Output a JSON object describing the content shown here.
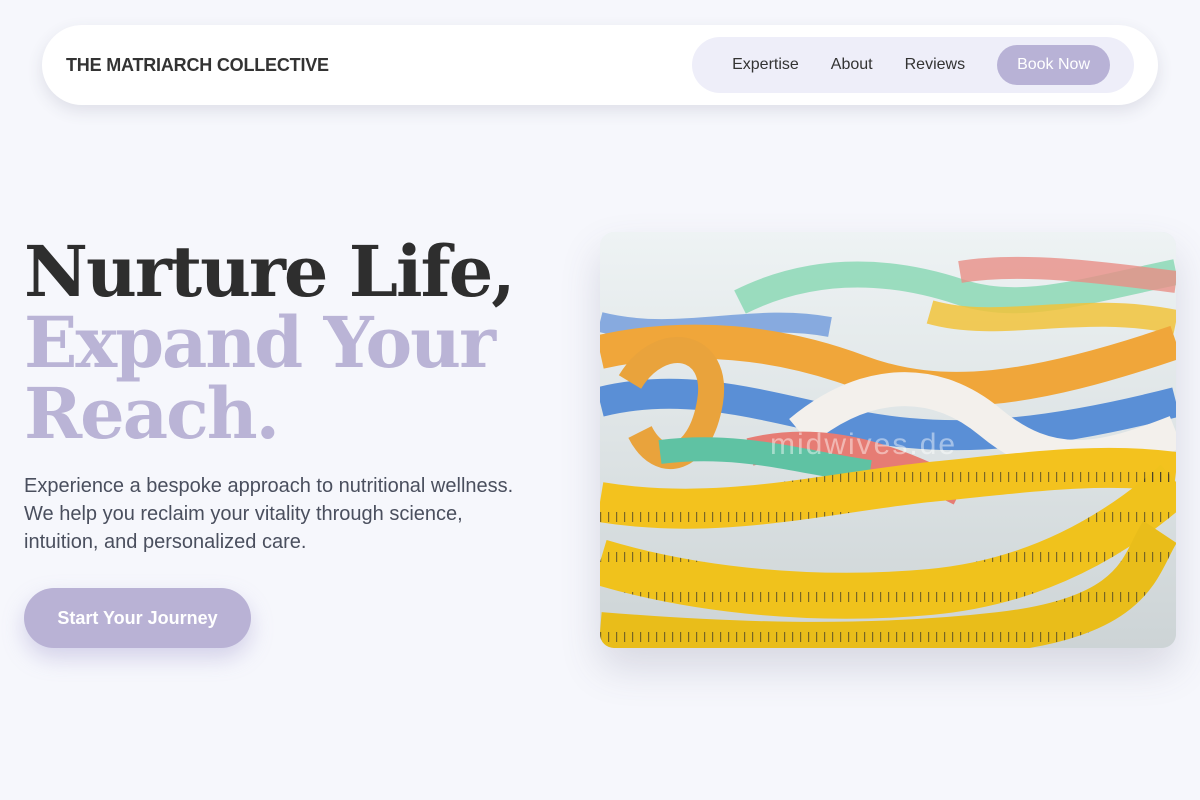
{
  "brand": {
    "name": "THE MATRIARCH COLLECTIVE"
  },
  "nav": {
    "links": [
      "Expertise",
      "About",
      "Reviews"
    ],
    "cta_label": "Book Now"
  },
  "hero": {
    "title_line1": "Nurture Life,",
    "title_line2": "Expand Your",
    "title_line3": "Reach.",
    "subtitle": "Experience a bespoke approach to nutritional wellness. We help you reclaim your vitality through science, intuition, and personalized care.",
    "cta_label": "Start Your Journey",
    "image": {
      "subject": "pile of colorful measuring tapes",
      "watermark": "midwives.de"
    }
  },
  "colors": {
    "accent": "#b9b2d5",
    "text_dark": "#2e2e2e",
    "background": "#f6f7fc",
    "nav_pill": "#eeeef9"
  }
}
